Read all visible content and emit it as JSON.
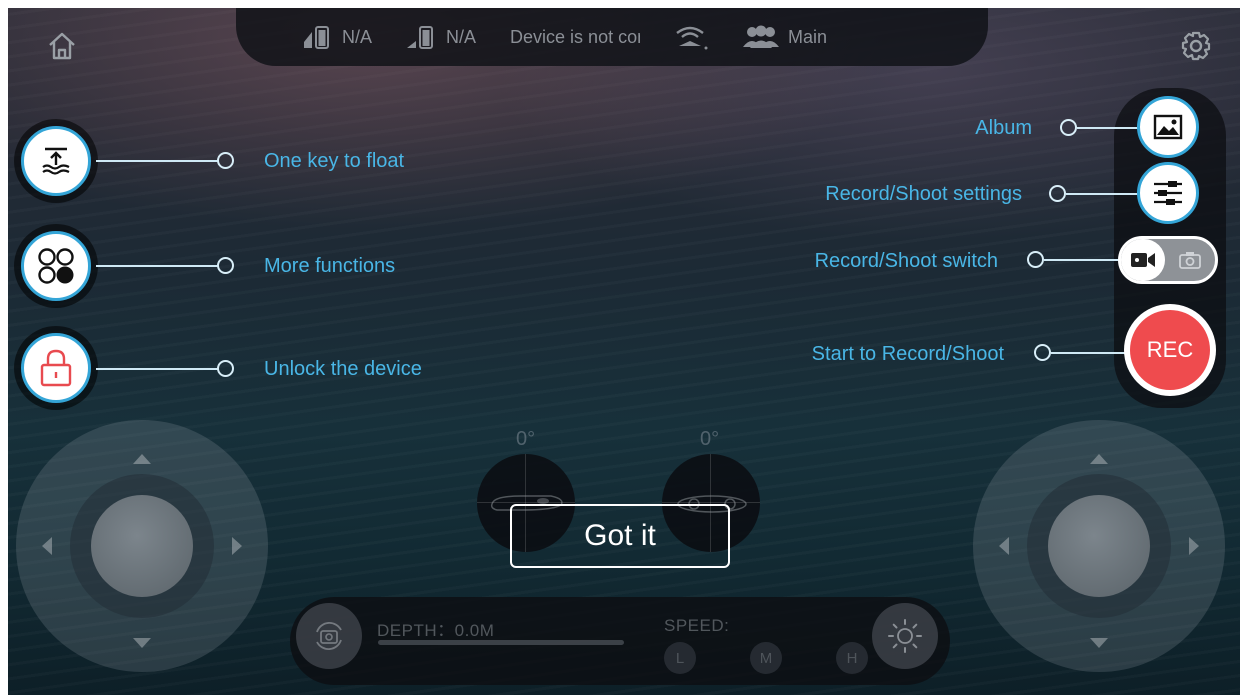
{
  "top_bar": {
    "battery_1": "N/A",
    "battery_2": "N/A",
    "device_status": "Device is not con",
    "user_mode": "Main"
  },
  "left_callouts": {
    "float": "One key to float",
    "more": "More functions",
    "unlock": "Unlock the device"
  },
  "right_callouts": {
    "album": "Album",
    "settings": "Record/Shoot settings",
    "switch": "Record/Shoot switch",
    "record": "Start to Record/Shoot"
  },
  "rec_label": "REC",
  "attitude": {
    "pitch": "0°",
    "roll": "0°"
  },
  "got_it_label": "Got it",
  "bottom_bar": {
    "depth": "DEPTH：0.0M",
    "speed": "SPEED:",
    "speed_levels": [
      "L",
      "M",
      "H"
    ]
  },
  "colors": {
    "accent": "#34a5d7",
    "callout_text": "#49b6e6",
    "rec": "#ef4b4e",
    "lock": "#e84a4f"
  },
  "icons": {
    "home": "home-icon",
    "settings": "gear-icon",
    "float": "float-up-icon",
    "more": "grid-circles-icon",
    "unlock": "lock-icon",
    "album": "image-icon",
    "record_settings": "sliders-icon",
    "video": "video-camera-icon",
    "photo": "camera-icon",
    "rotate_camera": "camera-rotate-icon",
    "light": "sun-icon"
  }
}
